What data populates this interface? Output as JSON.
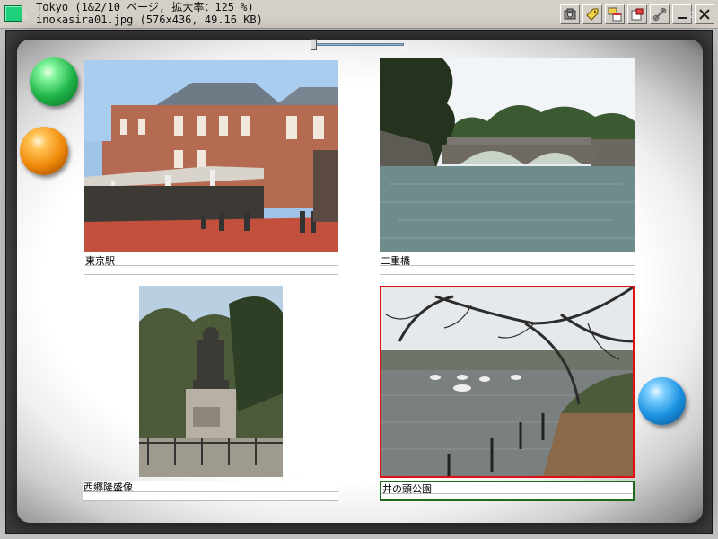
{
  "window": {
    "title_line1": "Tokyo (1&2/10 ページ, 拡大率：125 %)",
    "title_line2": "inokasira01.jpg (576x436, 49.16 KB)"
  },
  "toolbar": {
    "buttons": [
      {
        "name": "camera-icon"
      },
      {
        "name": "tag-icon"
      },
      {
        "name": "windows-icon"
      },
      {
        "name": "export-icon"
      },
      {
        "name": "link-icon"
      },
      {
        "name": "minimize-icon"
      },
      {
        "name": "close-icon"
      }
    ]
  },
  "pager": {
    "left_page": "1",
    "right_page": "2",
    "zoom_position": 0.05
  },
  "colors": {
    "selected_border": "#e01010",
    "selected_caption_border": "#1e6b1e",
    "frame": "#3c3c3c"
  },
  "photos": [
    {
      "caption": "東京駅",
      "subject": "brick station building"
    },
    {
      "caption": "二重橋",
      "subject": "stone bridge over moat"
    },
    {
      "caption": "西郷隆盛像",
      "subject": "statue"
    },
    {
      "caption": "井の頭公園",
      "subject": "pond with boats and trees",
      "selected": true
    }
  ]
}
